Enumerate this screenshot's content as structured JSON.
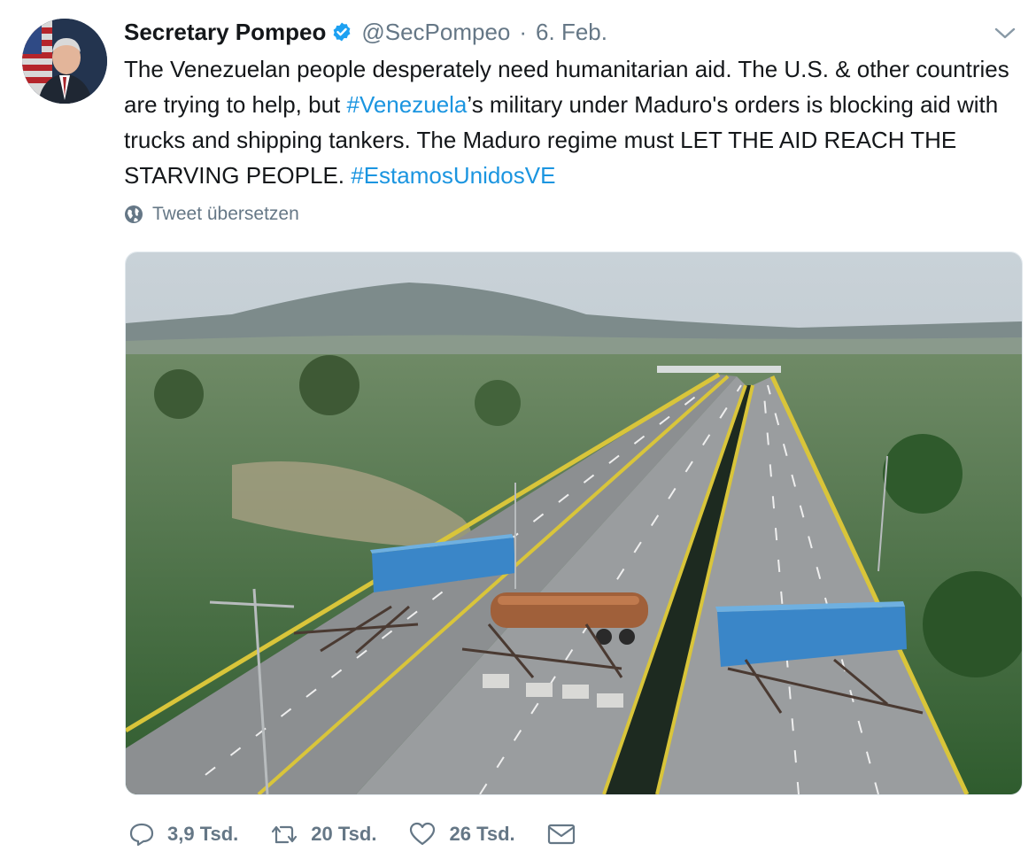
{
  "tweet": {
    "author_name": "Secretary Pompeo",
    "handle": "@SecPompeo",
    "separator": "·",
    "date": "6. Feb.",
    "text": {
      "part1": "The Venezuelan people desperately need humanitarian aid. The U.S. & other countries are trying to help, but ",
      "hashtag1": "#Venezuela",
      "part2": "’s military under Maduro's orders is blocking aid with trucks and shipping tankers. The Maduro regime must LET THE AID REACH THE STARVING PEOPLE. ",
      "hashtag2": "#EstamosUnidosVE"
    },
    "translate_label": "Tweet übersetzen",
    "actions": {
      "replies": "3,9 Tsd.",
      "retweets": "20 Tsd.",
      "likes": "26 Tsd."
    }
  },
  "icons": {
    "verified": "verified-badge-icon",
    "menu": "chevron-down-icon",
    "translate": "globe-icon",
    "reply": "reply-icon",
    "retweet": "retweet-icon",
    "like": "heart-icon",
    "message": "envelope-icon"
  },
  "colors": {
    "link": "#1b95e0",
    "secondary": "#657786",
    "text": "#14171a"
  }
}
